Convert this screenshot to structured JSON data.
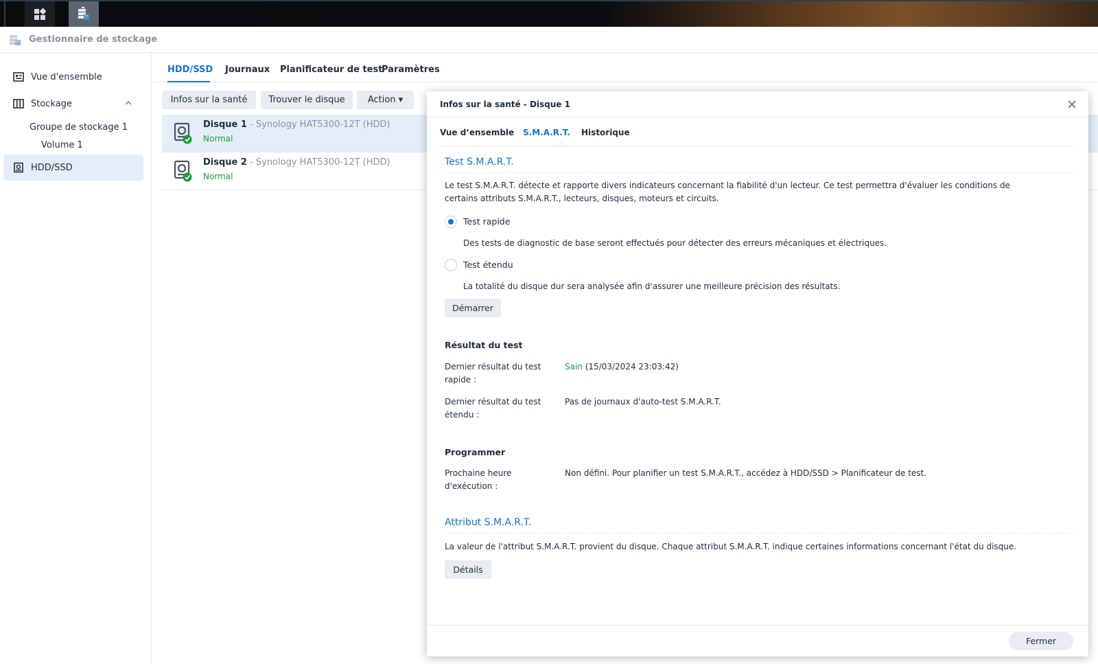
{
  "app": {
    "title": "Gestionnaire de stockage"
  },
  "sidebar": {
    "overview": "Vue d'ensemble",
    "storage": "Stockage",
    "pool": "Groupe de stockage 1",
    "volume": "Volume 1",
    "hdd": "HDD/SSD"
  },
  "main_tabs": [
    "HDD/SSD",
    "Journaux",
    "Planificateur de test",
    "Paramètres"
  ],
  "toolbar": {
    "health": "Infos sur la santé",
    "locate": "Trouver le disque",
    "action": "Action ▾"
  },
  "disks": [
    {
      "name": "Disque 1",
      "model": " - Synology HAT5300-12T (HDD)",
      "status": "Normal"
    },
    {
      "name": "Disque 2",
      "model": " - Synology HAT5300-12T (HDD)",
      "status": "Normal"
    }
  ],
  "dialog": {
    "title": "Infos sur la santé - Disque 1",
    "tabs": [
      "Vue d’ensemble",
      "S.M.A.R.T.",
      "Historique"
    ],
    "smart_test": {
      "title": "Test S.M.A.R.T.",
      "desc_line1": "Le test S.M.A.R.T. détecte et rapporte divers indicateurs concernant la fiabilité d'un lecteur. Ce test permettra d'évaluer les conditions de",
      "desc_line2": "certains attributs S.M.A.R.T., lecteurs, disques, moteurs et circuits.",
      "quick_label": "Test rapide",
      "quick_desc": "Des tests de diagnostic de base seront effectués pour détecter des erreurs mécaniques et électriques.",
      "extended_label": "Test étendu",
      "extended_desc": "La totalité du disque dur sera analysée afin d'assurer une meilleure précision des résultats.",
      "start": "Démarrer"
    },
    "result": {
      "title": "Résultat du test",
      "quick_key_1": "Dernier résultat du test",
      "quick_key_2": "rapide :",
      "quick_status": "Sain",
      "quick_date": " (15/03/2024 23:03:42)",
      "ext_key_1": "Dernier résultat du test",
      "ext_key_2": "étendu :",
      "ext_value": "Pas de journaux d'auto-test S.M.A.R.T."
    },
    "schedule": {
      "title": "Programmer",
      "key_1": "Prochaine heure",
      "key_2": "d'exécution :",
      "value": "Non défini. Pour planifier un test S.M.A.R.T., accédez à HDD/SSD > Planificateur de test."
    },
    "attribute": {
      "title": "Attribut S.M.A.R.T.",
      "desc": "La valeur de l'attribut S.M.A.R.T. provient du disque. Chaque attribut S.M.A.R.T. indique certaines informations concernant l'état du disque.",
      "details": "Détails"
    },
    "close": "Fermer"
  }
}
